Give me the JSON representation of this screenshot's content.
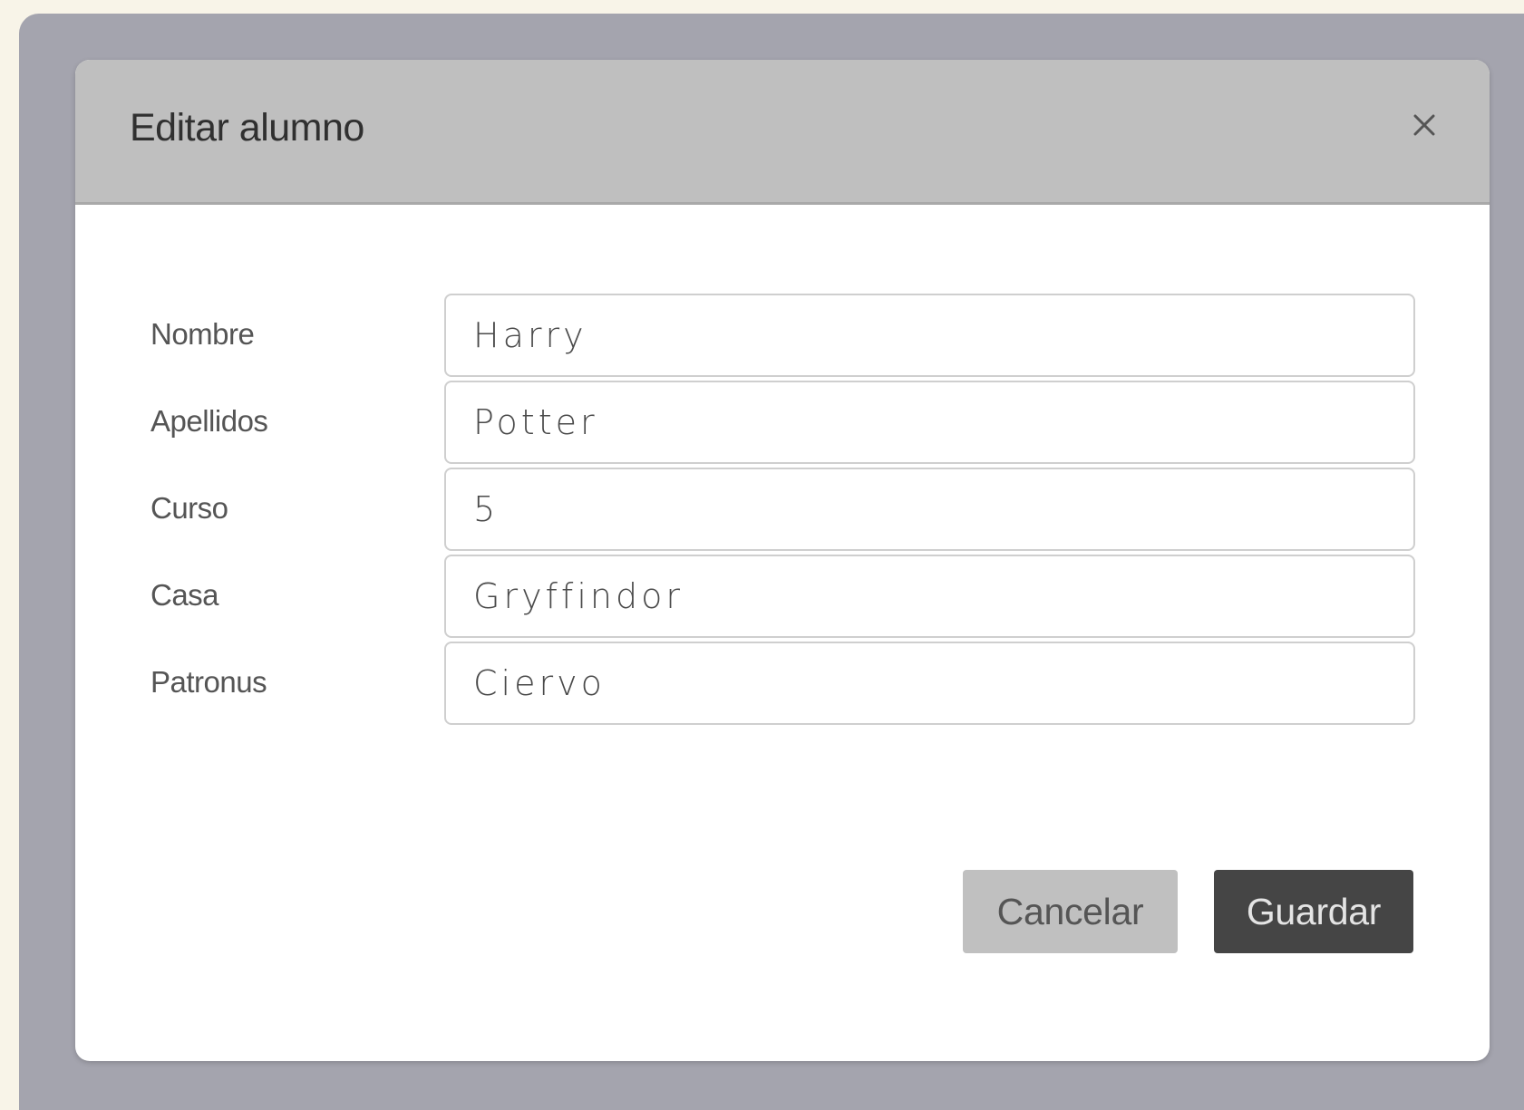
{
  "modal": {
    "title": "Editar alumno",
    "close_icon": "close-icon"
  },
  "form": {
    "fields": [
      {
        "label": "Nombre",
        "value": "Harry"
      },
      {
        "label": "Apellidos",
        "value": "Potter"
      },
      {
        "label": "Curso",
        "value": "5"
      },
      {
        "label": "Casa",
        "value": "Gryffindor"
      },
      {
        "label": "Patronus",
        "value": "Ciervo"
      }
    ]
  },
  "actions": {
    "cancel_label": "Cancelar",
    "save_label": "Guardar"
  },
  "colors": {
    "page_background": "#f8f4e8",
    "overlay": "#a4a4ae",
    "header_background": "#bfbfbf",
    "cancel_button": "#c0c0c0",
    "save_button": "#454545"
  }
}
